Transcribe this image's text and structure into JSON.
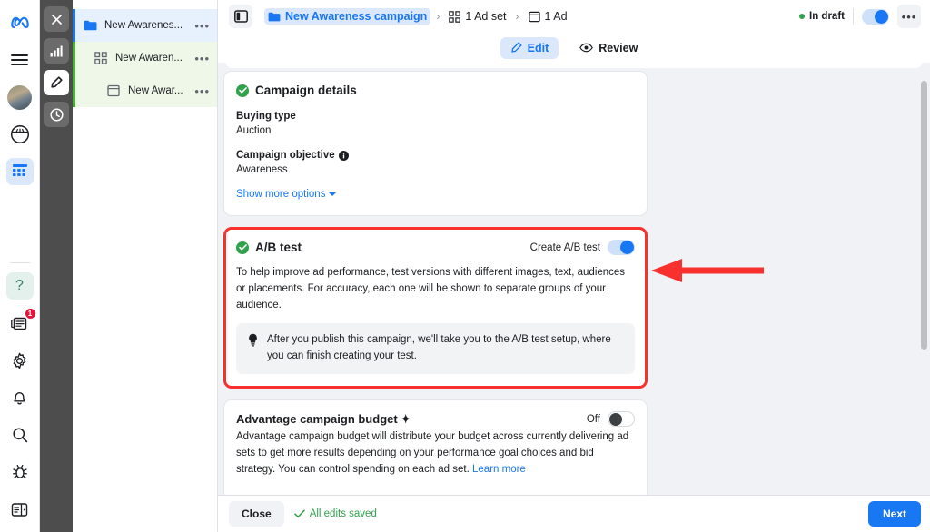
{
  "colors": {
    "brand_blue": "#1877f2",
    "green": "#31a24c",
    "annotation_red": "#f8312f",
    "surface": "#f0f2f5"
  },
  "left_rail": {
    "items": [
      {
        "name": "meta-logo",
        "label": "Meta"
      },
      {
        "name": "menu",
        "label": "Menu"
      },
      {
        "name": "avatar",
        "label": "Account"
      },
      {
        "name": "dashboard",
        "label": "Dashboard"
      },
      {
        "name": "ads-manager",
        "label": "Ads Manager"
      }
    ],
    "bottom_items": [
      {
        "name": "help",
        "label": "?"
      },
      {
        "name": "news",
        "label": "News",
        "badge": "1"
      },
      {
        "name": "settings",
        "label": "Settings"
      },
      {
        "name": "notifications",
        "label": "Notifications"
      },
      {
        "name": "search",
        "label": "Search"
      },
      {
        "name": "bug",
        "label": "Report a bug"
      },
      {
        "name": "panel",
        "label": "Toggle panel"
      }
    ]
  },
  "mini_sidebar": {
    "items": [
      {
        "name": "close",
        "label": "Close",
        "active": false
      },
      {
        "name": "chart",
        "label": "Performance",
        "active": false
      },
      {
        "name": "edit",
        "label": "Edit",
        "active": true
      },
      {
        "name": "history",
        "label": "History",
        "active": false
      }
    ]
  },
  "object_list": {
    "rows": [
      {
        "icon": "folder-icon",
        "label": "New Awarenes...",
        "type": "campaign",
        "menu": "•••"
      },
      {
        "icon": "adset-icon",
        "label": "New Awaren...",
        "type": "adset",
        "menu": "•••"
      },
      {
        "icon": "ad-icon",
        "label": "New Awar...",
        "type": "ad",
        "menu": "•••"
      }
    ]
  },
  "topbar": {
    "panel_toggle": "Toggle side panel",
    "breadcrumbs": [
      {
        "label": "New Awareness campaign",
        "icon": "folder-icon",
        "selected": true
      },
      {
        "label": "1 Ad set",
        "icon": "adset-icon",
        "selected": false
      },
      {
        "label": "1 Ad",
        "icon": "ad-icon",
        "selected": false
      }
    ],
    "separator": "›",
    "status": "In draft",
    "status_toggle_on": true,
    "more_menu": "•••"
  },
  "tabs": [
    {
      "label": "Edit",
      "icon": "pencil-icon",
      "active": true
    },
    {
      "label": "Review",
      "icon": "eye-icon",
      "active": false
    }
  ],
  "campaign_details": {
    "title": "Campaign details",
    "buying_type_label": "Buying type",
    "buying_type_value": "Auction",
    "objective_label": "Campaign objective",
    "objective_info_icon": "info-icon",
    "objective_value": "Awareness",
    "show_more": "Show more options"
  },
  "ab_test": {
    "title": "A/B test",
    "toggle_label": "Create A/B test",
    "toggle_on": true,
    "description": "To help improve ad performance, test versions with different images, text, audiences or placements. For accuracy, each one will be shown to separate groups of your audience.",
    "tip_icon": "lightbulb-icon",
    "tip": "After you publish this campaign, we'll take you to the A/B test setup, where you can finish creating your test."
  },
  "advantage_budget": {
    "title": "Advantage campaign budget ✦",
    "toggle_state_label": "Off",
    "toggle_on": false,
    "description": "Advantage campaign budget will distribute your budget across currently delivering ad sets to get more results depending on your performance goal choices and bid strategy. You can control spending on each ad set.",
    "learn_more": "Learn more"
  },
  "footer": {
    "close_label": "Close",
    "saved_label": "All edits saved",
    "next_label": "Next"
  },
  "annotation": {
    "arrow_direction": "left",
    "target": "create-ab-test-toggle"
  }
}
